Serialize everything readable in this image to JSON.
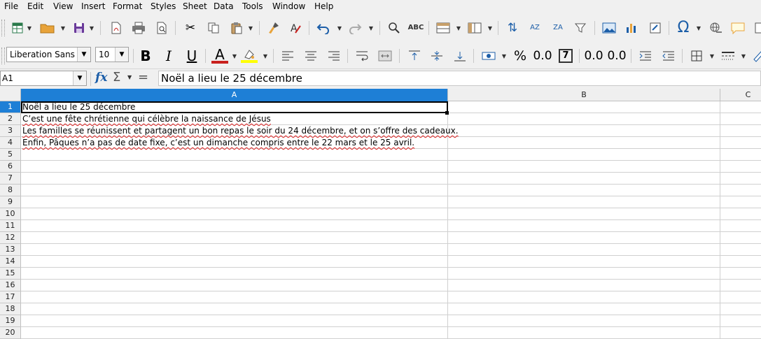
{
  "menu": [
    "File",
    "Edit",
    "View",
    "Insert",
    "Format",
    "Styles",
    "Sheet",
    "Data",
    "Tools",
    "Window",
    "Help"
  ],
  "toolbar_standard": {
    "icons": {
      "new": "new-spreadsheet-icon",
      "open": "open-folder-icon",
      "save": "save-icon",
      "export_pdf": "export-pdf-icon",
      "print": "print-icon",
      "print_preview": "print-preview-icon",
      "cut": "cut-icon",
      "copy": "copy-icon",
      "paste": "paste-icon",
      "clone": "clone-formatting-icon",
      "clear": "clear-formatting-icon",
      "undo": "undo-icon",
      "redo": "redo-icon",
      "find": "find-replace-icon",
      "spelling": "spelling-icon",
      "row": "row-icon",
      "column": "column-icon",
      "sort": "sort-icon",
      "sort_asc": "sort-ascending-icon",
      "sort_desc": "sort-descending-icon",
      "autofilter": "autofilter-icon",
      "image": "insert-image-icon",
      "chart": "insert-chart-icon",
      "pivot": "pivot-table-icon",
      "special_char": "special-character-icon",
      "hyperlink": "hyperlink-icon",
      "comment": "comment-icon"
    },
    "spelling_label": "ABC",
    "sort_asc_label": "AZ",
    "sort_desc_label": "ZA",
    "special_char_label": "Ω"
  },
  "toolbar_formatting": {
    "font_name": "Liberation Sans",
    "font_size": "10",
    "bold_label": "B",
    "italic_label": "I",
    "underline_label": "U",
    "font_color_label": "A",
    "percent_label": "%",
    "decimal_label": "0.0",
    "add_decimal_label": "0.0",
    "del_decimal_label": "0.0",
    "number_format_label": "7",
    "colors": {
      "font_color": "#c9211e",
      "highlight": "#ffff00"
    }
  },
  "formula_bar": {
    "name_box": "A1",
    "fx_label": "fx",
    "sum_label": "Σ",
    "equals_label": "=",
    "content": "Noël a lieu le 25 décembre"
  },
  "sheet": {
    "columns": [
      "A",
      "B",
      "C"
    ],
    "selected_column": "A",
    "rows": [
      "1",
      "2",
      "3",
      "4",
      "5",
      "6",
      "7",
      "8",
      "9",
      "10",
      "11",
      "12",
      "13",
      "14",
      "15",
      "16",
      "17",
      "18",
      "19",
      "20"
    ],
    "selected_row": "1",
    "cells": {
      "A1": "Noël a lieu le 25 décembre",
      "A2": "C’est une fête chrétienne qui célèbre la naissance de Jésus",
      "A3": "Les familles se réunissent et partagent un bon repas le soir du 24 décembre, et on s’offre des cadeaux.",
      "A4": "Enfin, Pâques n’a pas de date fixe, c’est un dimanche compris entre le 22 mars et le 25 avril."
    }
  },
  "colors": {
    "selection_header": "#1e7fd6",
    "spell_underline": "#e02020"
  }
}
